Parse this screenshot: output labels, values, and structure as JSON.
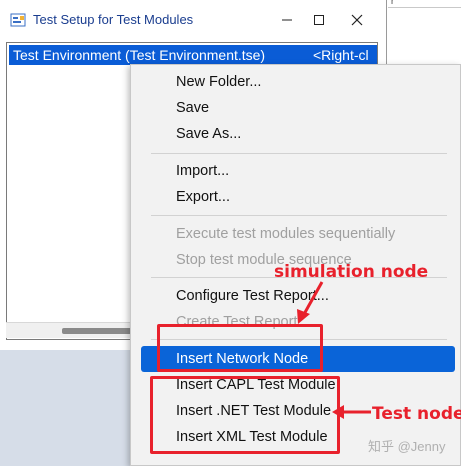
{
  "window": {
    "title": "Test Setup for Test Modules",
    "controls": {
      "minimize": "–",
      "maximize": "☐",
      "close": "✕"
    }
  },
  "right_strip": {
    "text": "r"
  },
  "tree": {
    "row_label": "Test Environment  (Test Environment.tse)",
    "row_hint": "<Right-cl"
  },
  "menu": {
    "items": [
      {
        "label": "New Folder...",
        "state": "enabled"
      },
      {
        "label": "Save",
        "state": "enabled"
      },
      {
        "label": "Save As...",
        "state": "enabled"
      },
      {
        "label": "Import...",
        "state": "enabled"
      },
      {
        "label": "Export...",
        "state": "enabled"
      },
      {
        "label": "Execute test modules sequentially",
        "state": "disabled"
      },
      {
        "label": "Stop test module sequence",
        "state": "disabled"
      },
      {
        "label": "Configure Test Report...",
        "state": "enabled"
      },
      {
        "label": "Create Test Report",
        "state": "disabled"
      },
      {
        "label": "Insert Network Node",
        "state": "selected"
      },
      {
        "label": "Insert CAPL Test Module",
        "state": "enabled"
      },
      {
        "label": "Insert .NET Test Module",
        "state": "enabled"
      },
      {
        "label": "Insert XML Test Module",
        "state": "enabled"
      }
    ]
  },
  "annotations": {
    "simulation_label": "simulation node",
    "test_label": "Test node",
    "color": "#e8212c"
  },
  "watermark": "知乎 @Jenny",
  "colors": {
    "selection": "#0a64d8",
    "title_text": "#1a3d8f",
    "menu_bg": "#f2f2f2"
  }
}
